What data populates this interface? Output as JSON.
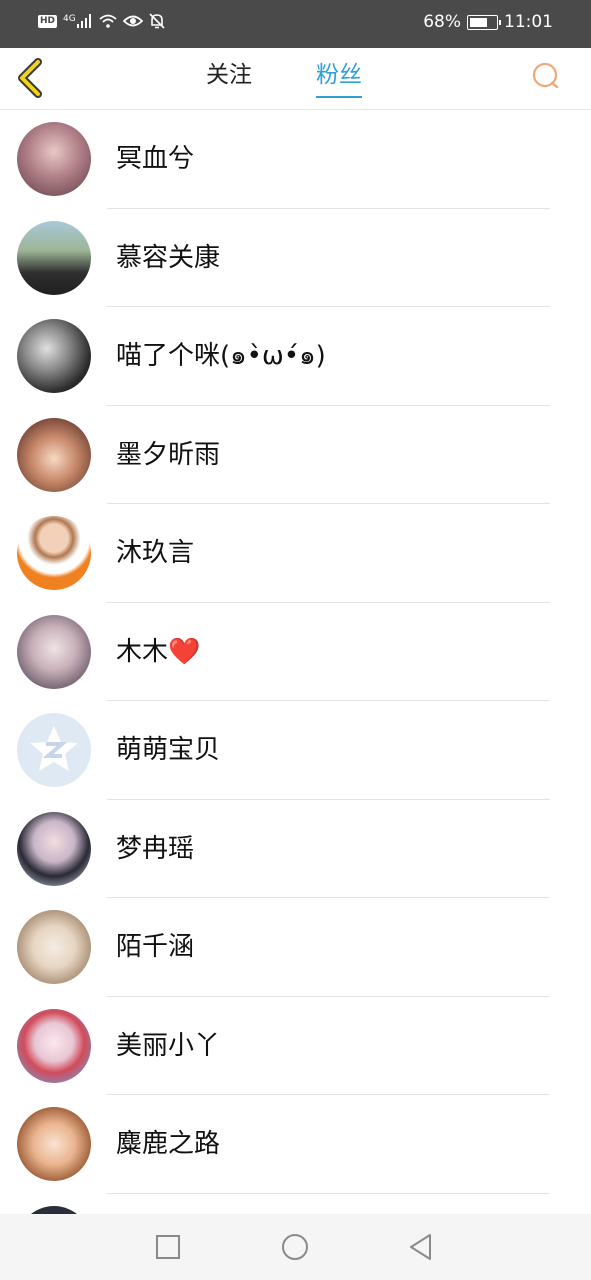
{
  "status_bar": {
    "hd": "HD",
    "network": "4G",
    "battery_percent": "68%",
    "battery_level": 0.68,
    "time": "11:01"
  },
  "nav": {
    "tab_follow": "关注",
    "tab_fans": "粉丝",
    "active_tab": "粉丝",
    "accent_color": "#2f9fd8",
    "back_icon": "chevron-left-icon",
    "search_icon": "search-icon"
  },
  "fans": [
    {
      "name": "冥血兮"
    },
    {
      "name": "慕容关康"
    },
    {
      "name": "喵了个咪(๑•̀ω•́๑)"
    },
    {
      "name": "墨夕昕雨"
    },
    {
      "name": "沐玖言"
    },
    {
      "name": "木木❤️"
    },
    {
      "name": "萌萌宝贝"
    },
    {
      "name": "梦冉瑶"
    },
    {
      "name": "陌千涵"
    },
    {
      "name": "美丽小丫"
    },
    {
      "name": "麋鹿之路"
    }
  ],
  "bottom_nav": {
    "recent_icon": "square-icon",
    "home_icon": "circle-icon",
    "back_icon": "triangle-back-icon"
  }
}
